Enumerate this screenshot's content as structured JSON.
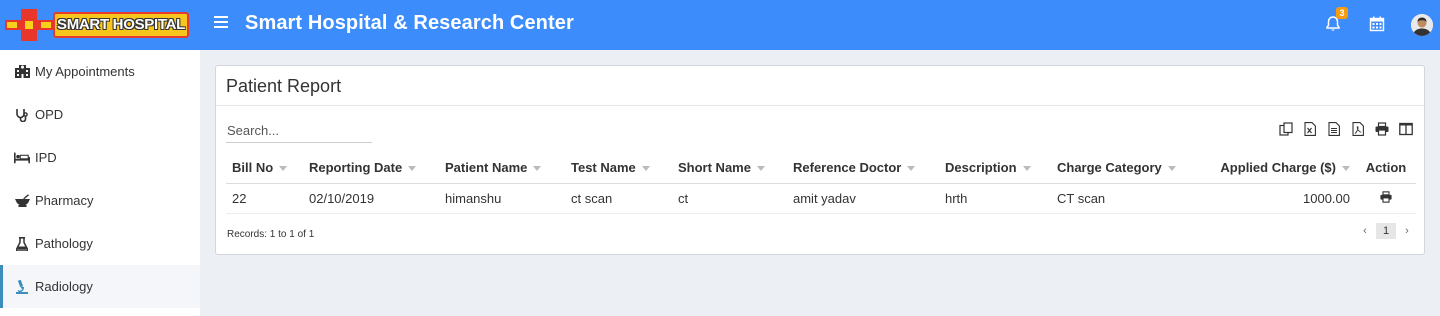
{
  "header": {
    "logo_text": "SMART HOSPITAL",
    "title": "Smart Hospital & Research Center",
    "notification_count": "3",
    "accent_color": "#3c8dfb"
  },
  "sidebar": {
    "items": [
      {
        "label": "My Appointments",
        "icon": "hospital-building-icon"
      },
      {
        "label": "OPD",
        "icon": "stethoscope-icon"
      },
      {
        "label": "IPD",
        "icon": "bed-icon"
      },
      {
        "label": "Pharmacy",
        "icon": "mortar-pestle-icon"
      },
      {
        "label": "Pathology",
        "icon": "flask-icon"
      },
      {
        "label": "Radiology",
        "icon": "microscope-icon",
        "active": true
      }
    ]
  },
  "report": {
    "title": "Patient Report",
    "search_placeholder": "Search...",
    "tools": [
      "copy-icon",
      "excel-icon",
      "csv-icon",
      "pdf-icon",
      "print-icon",
      "columns-icon"
    ],
    "columns": [
      "Bill No",
      "Reporting Date",
      "Patient Name",
      "Test Name",
      "Short Name",
      "Reference Doctor",
      "Description",
      "Charge Category",
      "Applied Charge ($)",
      "Action"
    ],
    "rows": [
      {
        "bill_no": "22",
        "reporting_date": "02/10/2019",
        "patient_name": "himanshu",
        "test_name": "ct scan",
        "short_name": "ct",
        "reference_doctor": "amit yadav",
        "description": "hrth",
        "charge_category": "CT scan",
        "applied_charge": "1000.00"
      }
    ],
    "records_text": "Records: 1 to 1 of 1",
    "pagination": {
      "prev": "‹",
      "current": "1",
      "next": "›"
    }
  }
}
